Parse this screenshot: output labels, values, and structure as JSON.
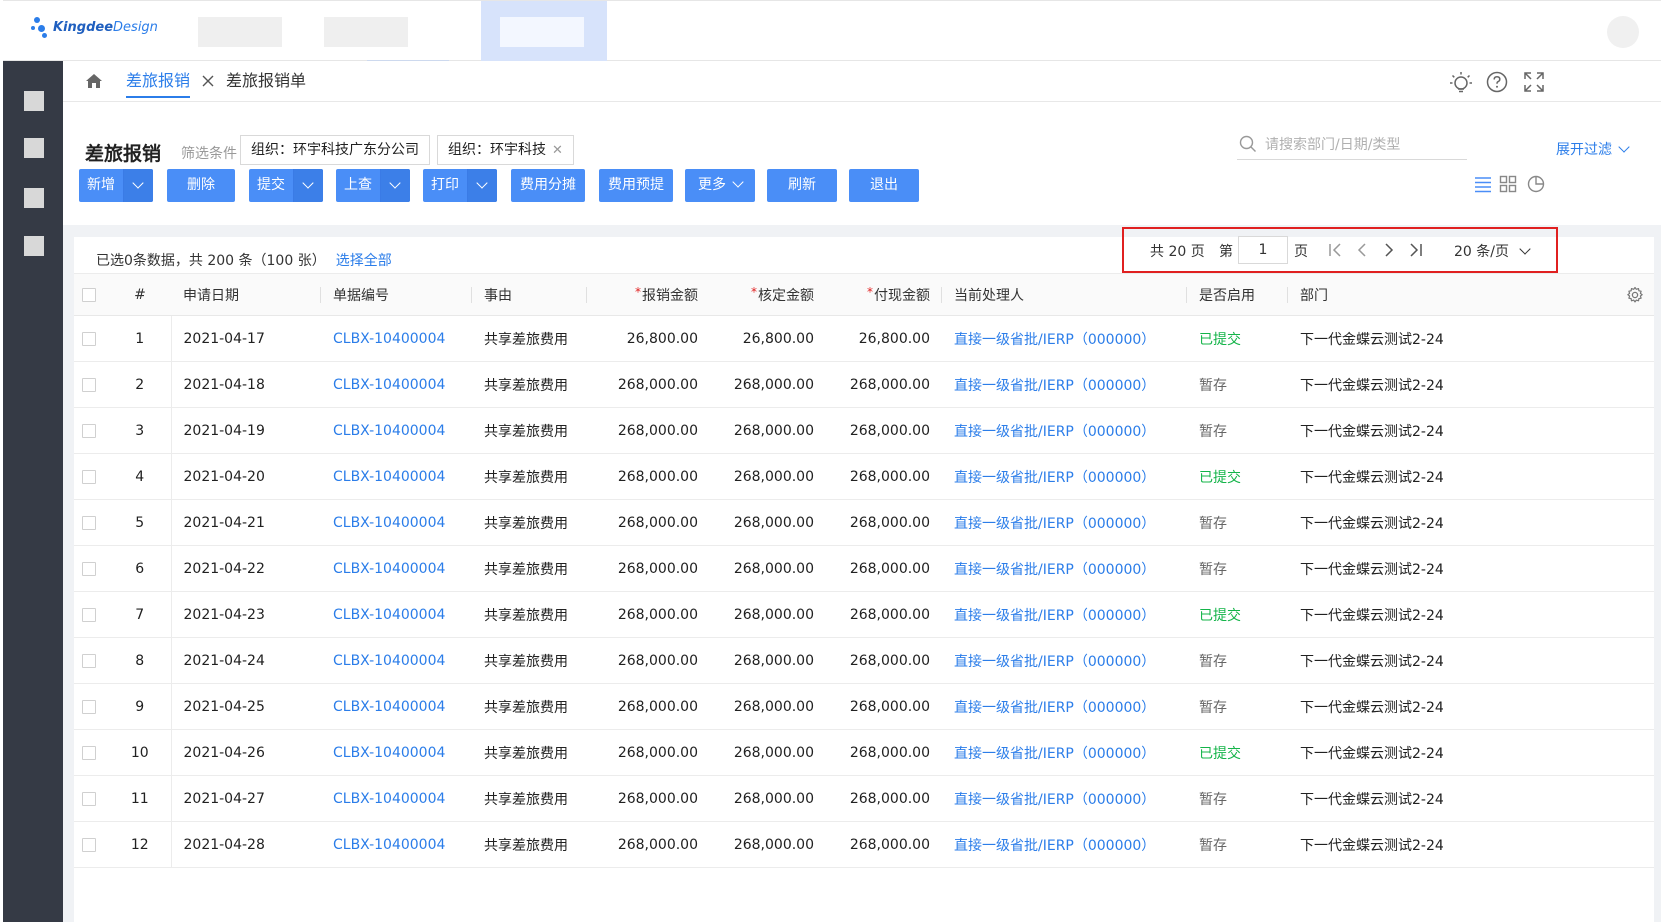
{
  "brand": {
    "name_bold": "Kingdee",
    "name_thin": "Design"
  },
  "breadcrumb": {
    "active": "差旅报销",
    "second": "差旅报销单"
  },
  "header": {
    "title": "差旅报销",
    "filter_label": "筛选条件",
    "chips": [
      {
        "label": "组织：环宇科技广东分公司",
        "closable": false
      },
      {
        "label": "组织：环宇科技",
        "closable": true
      }
    ],
    "search_placeholder": "请搜索部门/日期/类型",
    "expand_filter": "展开过滤"
  },
  "toolbar": {
    "buttons": [
      {
        "label": "新增",
        "split": true
      },
      {
        "label": "删除",
        "split": false
      },
      {
        "label": "提交",
        "split": true
      },
      {
        "label": "上查",
        "split": true
      },
      {
        "label": "打印",
        "split": true
      },
      {
        "label": "费用分摊",
        "split": false
      },
      {
        "label": "费用预提",
        "split": false
      },
      {
        "label": "更多",
        "split": false,
        "dropdown": true
      },
      {
        "label": "刷新",
        "split": false
      },
      {
        "label": "退出",
        "split": false
      }
    ]
  },
  "selection": {
    "info": "已选0条数据，共 200 条（100 张）",
    "select_all": "选择全部"
  },
  "pager": {
    "total_pages": "共 20 页",
    "di": "第",
    "current": "1",
    "ye": "页",
    "page_size": "20 条/页"
  },
  "table": {
    "columns": [
      "#",
      "申请日期",
      "单据编号",
      "事由",
      "报销金额",
      "核定金额",
      "付现金额",
      "当前处理人",
      "是否启用",
      "部门"
    ],
    "rows": [
      {
        "idx": "1",
        "date": "2021-04-17",
        "code": "CLBX-10400004",
        "reason": "共享差旅费用",
        "amt1": "26,800.00",
        "amt2": "26,800.00",
        "amt3": "26,800.00",
        "handler": "直接一级省批/IERP（000000）",
        "status": "已提交",
        "status_type": "submitted",
        "dept": "下一代金蝶云测试2-24"
      },
      {
        "idx": "2",
        "date": "2021-04-18",
        "code": "CLBX-10400004",
        "reason": "共享差旅费用",
        "amt1": "268,000.00",
        "amt2": "268,000.00",
        "amt3": "268,000.00",
        "handler": "直接一级省批/IERP（000000）",
        "status": "暂存",
        "status_type": "draft",
        "dept": "下一代金蝶云测试2-24"
      },
      {
        "idx": "3",
        "date": "2021-04-19",
        "code": "CLBX-10400004",
        "reason": "共享差旅费用",
        "amt1": "268,000.00",
        "amt2": "268,000.00",
        "amt3": "268,000.00",
        "handler": "直接一级省批/IERP（000000）",
        "status": "暂存",
        "status_type": "draft",
        "dept": "下一代金蝶云测试2-24"
      },
      {
        "idx": "4",
        "date": "2021-04-20",
        "code": "CLBX-10400004",
        "reason": "共享差旅费用",
        "amt1": "268,000.00",
        "amt2": "268,000.00",
        "amt3": "268,000.00",
        "handler": "直接一级省批/IERP（000000）",
        "status": "已提交",
        "status_type": "submitted",
        "dept": "下一代金蝶云测试2-24"
      },
      {
        "idx": "5",
        "date": "2021-04-21",
        "code": "CLBX-10400004",
        "reason": "共享差旅费用",
        "amt1": "268,000.00",
        "amt2": "268,000.00",
        "amt3": "268,000.00",
        "handler": "直接一级省批/IERP（000000）",
        "status": "暂存",
        "status_type": "draft",
        "dept": "下一代金蝶云测试2-24"
      },
      {
        "idx": "6",
        "date": "2021-04-22",
        "code": "CLBX-10400004",
        "reason": "共享差旅费用",
        "amt1": "268,000.00",
        "amt2": "268,000.00",
        "amt3": "268,000.00",
        "handler": "直接一级省批/IERP（000000）",
        "status": "暂存",
        "status_type": "draft",
        "dept": "下一代金蝶云测试2-24"
      },
      {
        "idx": "7",
        "date": "2021-04-23",
        "code": "CLBX-10400004",
        "reason": "共享差旅费用",
        "amt1": "268,000.00",
        "amt2": "268,000.00",
        "amt3": "268,000.00",
        "handler": "直接一级省批/IERP（000000）",
        "status": "已提交",
        "status_type": "submitted",
        "dept": "下一代金蝶云测试2-24"
      },
      {
        "idx": "8",
        "date": "2021-04-24",
        "code": "CLBX-10400004",
        "reason": "共享差旅费用",
        "amt1": "268,000.00",
        "amt2": "268,000.00",
        "amt3": "268,000.00",
        "handler": "直接一级省批/IERP（000000）",
        "status": "暂存",
        "status_type": "draft",
        "dept": "下一代金蝶云测试2-24"
      },
      {
        "idx": "9",
        "date": "2021-04-25",
        "code": "CLBX-10400004",
        "reason": "共享差旅费用",
        "amt1": "268,000.00",
        "amt2": "268,000.00",
        "amt3": "268,000.00",
        "handler": "直接一级省批/IERP（000000）",
        "status": "暂存",
        "status_type": "draft",
        "dept": "下一代金蝶云测试2-24"
      },
      {
        "idx": "10",
        "date": "2021-04-26",
        "code": "CLBX-10400004",
        "reason": "共享差旅费用",
        "amt1": "268,000.00",
        "amt2": "268,000.00",
        "amt3": "268,000.00",
        "handler": "直接一级省批/IERP（000000）",
        "status": "已提交",
        "status_type": "submitted",
        "dept": "下一代金蝶云测试2-24"
      },
      {
        "idx": "11",
        "date": "2021-04-27",
        "code": "CLBX-10400004",
        "reason": "共享差旅费用",
        "amt1": "268,000.00",
        "amt2": "268,000.00",
        "amt3": "268,000.00",
        "handler": "直接一级省批/IERP（000000）",
        "status": "暂存",
        "status_type": "draft",
        "dept": "下一代金蝶云测试2-24"
      },
      {
        "idx": "12",
        "date": "2021-04-28",
        "code": "CLBX-10400004",
        "reason": "共享差旅费用",
        "amt1": "268,000.00",
        "amt2": "268,000.00",
        "amt3": "268,000.00",
        "handler": "直接一级省批/IERP（000000）",
        "status": "暂存",
        "status_type": "draft",
        "dept": "下一代金蝶云测试2-24"
      }
    ]
  },
  "colors": {
    "primary": "#2b7de9",
    "button": "#4a8ef7",
    "sidebar": "#353a45",
    "submitted": "#14b449",
    "highlight": "#e02020"
  },
  "icons": [
    "home-icon",
    "close-icon",
    "lightbulb-icon",
    "help-icon",
    "fullscreen-icon",
    "search-icon",
    "chevron-down-icon",
    "list-view-icon",
    "grid-view-icon",
    "chart-view-icon",
    "first-page-icon",
    "prev-page-icon",
    "next-page-icon",
    "last-page-icon",
    "gear-icon"
  ]
}
